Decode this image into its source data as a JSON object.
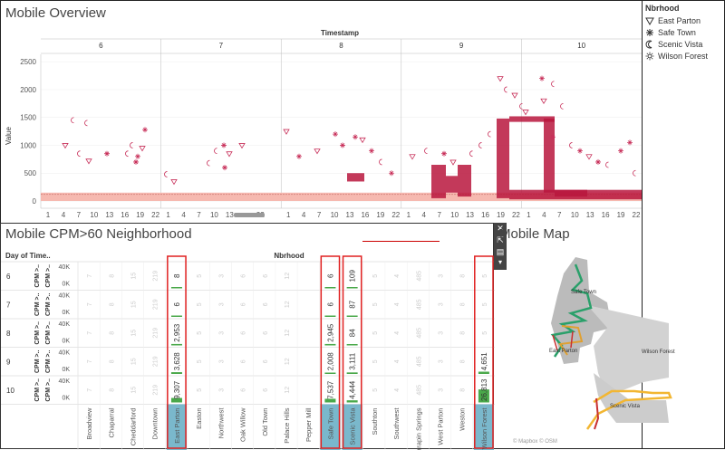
{
  "overview": {
    "title": "Mobile Overview",
    "column_header": "Timestamp",
    "day_labels": [
      "6",
      "7",
      "8",
      "9",
      "10"
    ],
    "y_axis_label": "Value",
    "y_ticks": [
      "0",
      "500",
      "1000",
      "1500",
      "2000",
      "2500"
    ],
    "x_tick_groups": [
      [
        "1",
        "4",
        "7",
        "10",
        "13",
        "16",
        "19",
        "22"
      ],
      [
        "1",
        "4",
        "7",
        "10",
        "13",
        "",
        "22"
      ],
      [
        "1",
        "4",
        "7",
        "10",
        "13",
        "16",
        "19",
        "22"
      ],
      [
        "1",
        "4",
        "7",
        "10",
        "13",
        "16",
        "19",
        "22"
      ],
      [
        "1",
        "4",
        "7",
        "10",
        "13",
        "16",
        "19",
        "22"
      ]
    ]
  },
  "legend": {
    "title": "Nbrhood",
    "items": [
      {
        "label": "East Parton",
        "icon": "triangle-down-icon"
      },
      {
        "label": "Safe Town",
        "icon": "asterisk-icon"
      },
      {
        "label": "Scenic Vista",
        "icon": "crescent-icon"
      },
      {
        "label": "Wilson Forest",
        "icon": "sun-icon"
      }
    ]
  },
  "cpm": {
    "title": "Mobile CPM>60 Neighborhood",
    "row_header": "Day of Time..",
    "col_header": "Nbrhood",
    "row_axis_label": "CPM >..",
    "rows": [
      "6",
      "7",
      "8",
      "9",
      "10"
    ],
    "y_ticks": [
      "40K",
      "0K"
    ],
    "neighborhoods": [
      "Broadview",
      "Chaparral",
      "Cheddarford",
      "Downtown",
      "East Parton",
      "Easton",
      "Northwest",
      "Oak Willow",
      "Old Town",
      "Palace Hills",
      "Pepper Mill",
      "Safe Town",
      "Scenic Vista",
      "Southton",
      "Southwest",
      "Terrapin Springs",
      "West Parton",
      "Weston",
      "Wilson Forest"
    ],
    "highlighted": [
      "East Parton",
      "Safe Town",
      "Scenic Vista",
      "Wilson Forest"
    ],
    "values": {
      "6": {
        "East Parton": "8",
        "Safe Town": "6",
        "Scenic Vista": "109"
      },
      "7": {
        "East Parton": "6",
        "Safe Town": "6",
        "Scenic Vista": "87"
      },
      "8": {
        "East Parton": "2,953",
        "Safe Town": "2,945",
        "Scenic Vista": "84"
      },
      "9": {
        "East Parton": "3,628",
        "Safe Town": "2,008",
        "Scenic Vista": "3,111",
        "Wilson Forest": "4,651"
      },
      "10": {
        "East Parton": "9,307",
        "Safe Town": "7,537",
        "Scenic Vista": "4,444",
        "Wilson Forest": "26,813"
      }
    }
  },
  "map": {
    "title": "Mobile Map",
    "labels": [
      "Safe Town",
      "East Parton",
      "Wilson Forest",
      "Scenic Vista"
    ],
    "credit": "© Mapbox © OSM"
  },
  "toolbar": {
    "close": "✕",
    "popout": "⇱",
    "bars": "▤",
    "filter": "▼",
    "more": "▾"
  }
}
